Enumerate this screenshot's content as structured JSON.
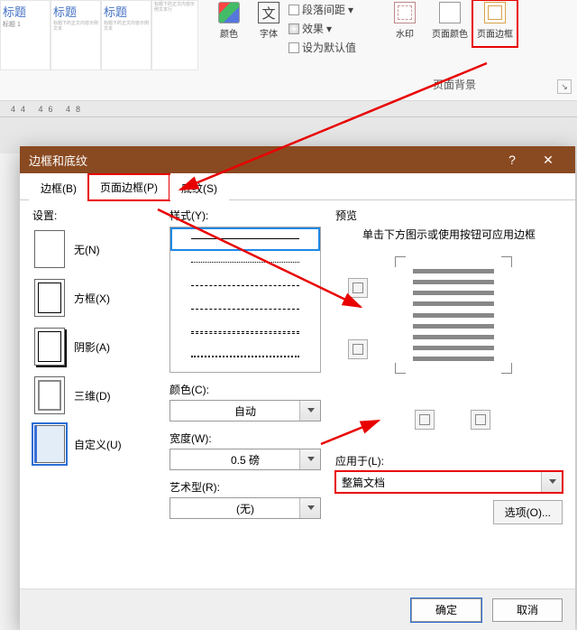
{
  "ribbon": {
    "styles": [
      {
        "heading": "标题",
        "sub": "标题 1"
      },
      {
        "heading": "标题",
        "sub": ""
      },
      {
        "heading": "标题",
        "sub": ""
      },
      {
        "heading": "",
        "sub": ""
      }
    ],
    "color_label": "颜色",
    "font_label": "字体",
    "font_glyph": "文",
    "line_spacing": "段落间距",
    "effects": "效果",
    "set_default": "设为默认值",
    "watermark": "水印",
    "page_color": "页面颜色",
    "page_border": "页面边框",
    "page_bg_group": "页面背景"
  },
  "ruler": "44 46 48",
  "dialog": {
    "title": "边框和底纹",
    "help_glyph": "?",
    "close_glyph": "✕",
    "tabs": {
      "border": "边框(B)",
      "page_border": "页面边框(P)",
      "shading": "底纹(S)"
    },
    "setting_label": "设置:",
    "settings": [
      {
        "key": "none",
        "label": "无(N)"
      },
      {
        "key": "box",
        "label": "方框(X)"
      },
      {
        "key": "shadow",
        "label": "阴影(A)"
      },
      {
        "key": "3d",
        "label": "三维(D)"
      },
      {
        "key": "custom",
        "label": "自定义(U)"
      }
    ],
    "style_label": "样式(Y):",
    "color_label": "颜色(C):",
    "color_value": "自动",
    "width_label": "宽度(W):",
    "width_value": "0.5 磅",
    "art_label": "艺术型(R):",
    "art_value": "(无)",
    "preview_label": "预览",
    "preview_hint": "单击下方图示或使用按钮可应用边框",
    "apply_label": "应用于(L):",
    "apply_value": "整篇文档",
    "options_btn": "选项(O)...",
    "ok": "确定",
    "cancel": "取消"
  }
}
